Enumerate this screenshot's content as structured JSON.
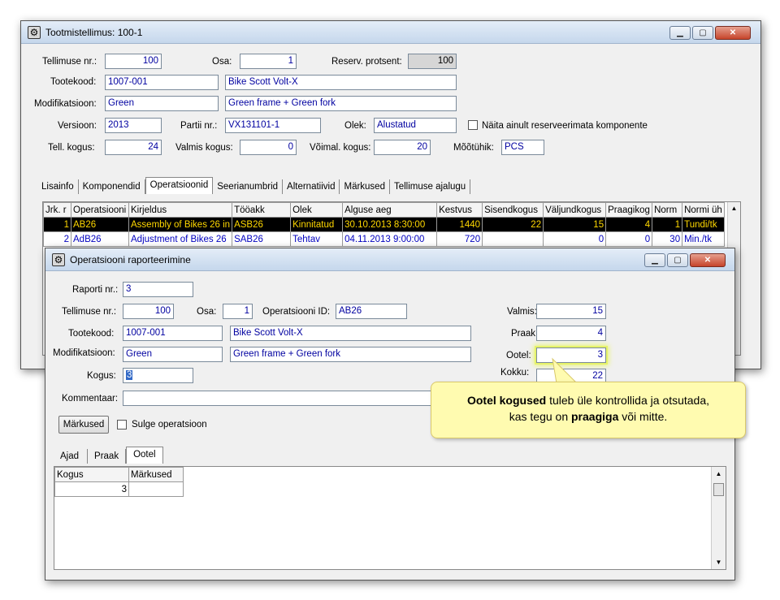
{
  "main": {
    "title": "Tootmistellimus: 100-1",
    "labels": {
      "tellimuse_nr": "Tellimuse nr.:",
      "osa": "Osa:",
      "reserv": "Reserv. protsent:",
      "tootekood": "Tootekood:",
      "modifikatsioon": "Modifikatsioon:",
      "versioon": "Versioon:",
      "partii": "Partii nr.:",
      "olek": "Olek:",
      "naita": "Näita ainult reserveerimata komponente",
      "tell_kogus": "Tell. kogus:",
      "valmis_kogus": "Valmis kogus:",
      "voimal_kogus": "Võimal. kogus:",
      "mootuhik": "Mõõtühik:"
    },
    "values": {
      "tellimuse_nr": "100",
      "osa": "1",
      "reserv": "100",
      "tootekood": "1007-001",
      "toote_nimi": "Bike Scott Volt-X",
      "modifikatsioon": "Green",
      "mod_kirjeldus": "Green frame + Green fork",
      "versioon": "2013",
      "partii": "VX131101-1",
      "olek": "Alustatud",
      "tell_kogus": "24",
      "valmis_kogus": "0",
      "voimal_kogus": "20",
      "mootuhik": "PCS"
    },
    "tabs": [
      "Lisainfo",
      "Komponendid",
      "Operatsioonid",
      "Seerianumbrid",
      "Alternatiivid",
      "Märkused",
      "Tellimuse ajalugu"
    ],
    "grid": {
      "headers": [
        "Jrk. r",
        "Operatsiooni",
        "Kirjeldus",
        "Tööakk",
        "Olek",
        "Alguse aeg",
        "Kestvus",
        "Sisendkogus",
        "Väljundkogus",
        "Praagikog",
        "Norm",
        "Normi üh"
      ],
      "rows": [
        [
          "1",
          "AB26",
          "Assembly of Bikes 26 in",
          "ASB26",
          "Kinnitatud",
          "30.10.2013 8:30:00",
          "1440",
          "22",
          "15",
          "4",
          "1",
          "Tundi/tk"
        ],
        [
          "2",
          "AdB26",
          "Adjustment of Bikes 26",
          "SAB26",
          "Tehtav",
          "04.11.2013 9:00:00",
          "720",
          "",
          "0",
          "0",
          "30",
          "Min./tk"
        ]
      ]
    }
  },
  "dialog": {
    "title": "Operatsiooni raporteerimine",
    "labels": {
      "raporti_nr": "Raporti nr.:",
      "tellimuse_nr": "Tellimuse nr.:",
      "osa": "Osa:",
      "operatsiooni_id": "Operatsiooni ID:",
      "tootekood": "Tootekood:",
      "modifikatsioon": "Modifikatsioon:",
      "kogus": "Kogus:",
      "kommentaar": "Kommentaar:",
      "valmis": "Valmis:",
      "praak": "Praak:",
      "ootel": "Ootel:",
      "kokku": "Kokku:"
    },
    "values": {
      "raporti_nr": "3",
      "tellimuse_nr": "100",
      "osa": "1",
      "operatsiooni_id": "AB26",
      "tootekood": "1007-001",
      "toote_nimi": "Bike Scott Volt-X",
      "modifikatsioon": "Green",
      "mod_kirjeldus": "Green frame + Green fork",
      "kogus": "3",
      "kommentaar": "",
      "valmis": "15",
      "praak": "4",
      "ootel": "3",
      "kokku": "22"
    },
    "markused_btn": "Märkused",
    "sulge": "Sulge operatsioon",
    "tabs": [
      "Ajad",
      "Praak",
      "Ootel"
    ],
    "grid_headers": [
      "Kogus",
      "Märkused"
    ],
    "grid_rows": [
      [
        "3",
        ""
      ]
    ]
  },
  "callout": {
    "bold1": "Ootel kogused",
    "text1": " tuleb üle kontrollida ja otsutada,",
    "text2a": "kas tegu on ",
    "bold2": "praagiga",
    "text2b": " või mitte."
  },
  "accent_highlight": "#e6f36a",
  "selected_row_bg": "#000000",
  "selected_row_fg": "#ffd800"
}
